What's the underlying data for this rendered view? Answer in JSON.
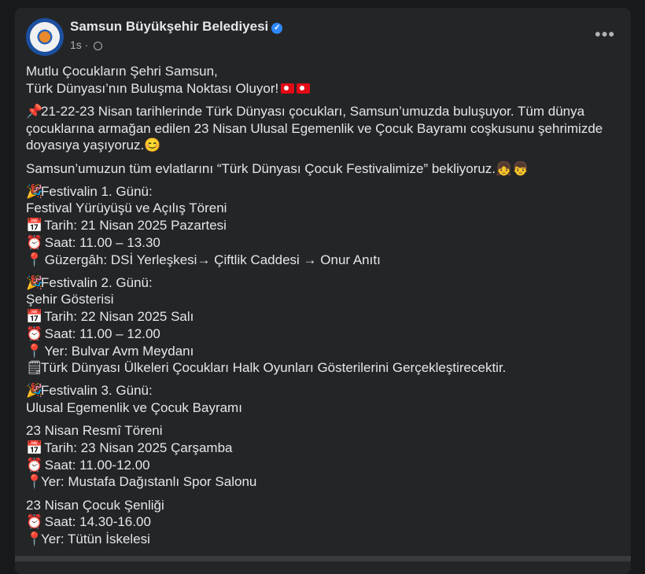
{
  "post": {
    "author": "Samsun Büyükşehir Belediyesi",
    "time": "1s",
    "lines": {
      "l1": "Mutlu Çocukların Şehri Samsun,",
      "l2": "Türk Dünyası’nın Buluşma Noktası Oluyor!",
      "l3": "21-22-23  Nisan tarihlerinde Türk Dünyası çocukları, Samsun’umuzda buluşuyor. Tüm dünya",
      "l4": "çocuklarına armağan edilen 23 Nisan Ulusal Egemenlik ve Çocuk Bayramı coşkusunu şehrimizde",
      "l5": "doyasıya yaşıyoruz.",
      "l6": "Samsun’umuzun tüm evlatlarını “Türk Dünyası Çocuk Festivalimize” bekliyoruz.",
      "d1_title": "Festivalin 1. Günü:",
      "d1_event": "Festival Yürüyüşü ve Açılış Töreni",
      "d1_date": "Tarih: 21 Nisan 2025 Pazartesi",
      "d1_time": "Saat: 11.00 – 13.30",
      "d1_route": "Güzergâh: DSİ Yerleşkesi→ Çiftlik Caddesi → Onur Anıtı",
      "d2_title": "Festivalin 2. Günü:",
      "d2_event": "Şehir Gösterisi",
      "d2_date": "Tarih: 22 Nisan 2025 Salı",
      "d2_time": "Saat: 11.00 – 12.00",
      "d2_place": "Yer: Bulvar Avm Meydanı",
      "d2_note": "Türk Dünyası Ülkeleri Çocukları Halk Oyunları Gösterilerini Gerçekleştirecektir.",
      "d3_title": "Festivalin 3. Günü:",
      "d3_event": "Ulusal Egemenlik ve Çocuk Bayramı",
      "c1_title": "23 Nisan Resmî Töreni",
      "c1_date": "Tarih: 23 Nisan 2025 Çarşamba",
      "c1_time": "Saat: 11.00-12.00",
      "c1_place": "Yer: Mustafa Dağıstanlı Spor Salonu",
      "c2_title": "23 Nisan Çocuk Şenliği",
      "c2_time": "Saat: 14.30-16.00",
      "c2_place": "Yer: Tütün İskelesi"
    }
  },
  "icons": {
    "pin": "📌",
    "party": "🎉",
    "calendar": "📅",
    "clock": "⏰",
    "pushpin": "📍",
    "note": "🗒️",
    "smile": "😊",
    "kids": "👧👦"
  }
}
